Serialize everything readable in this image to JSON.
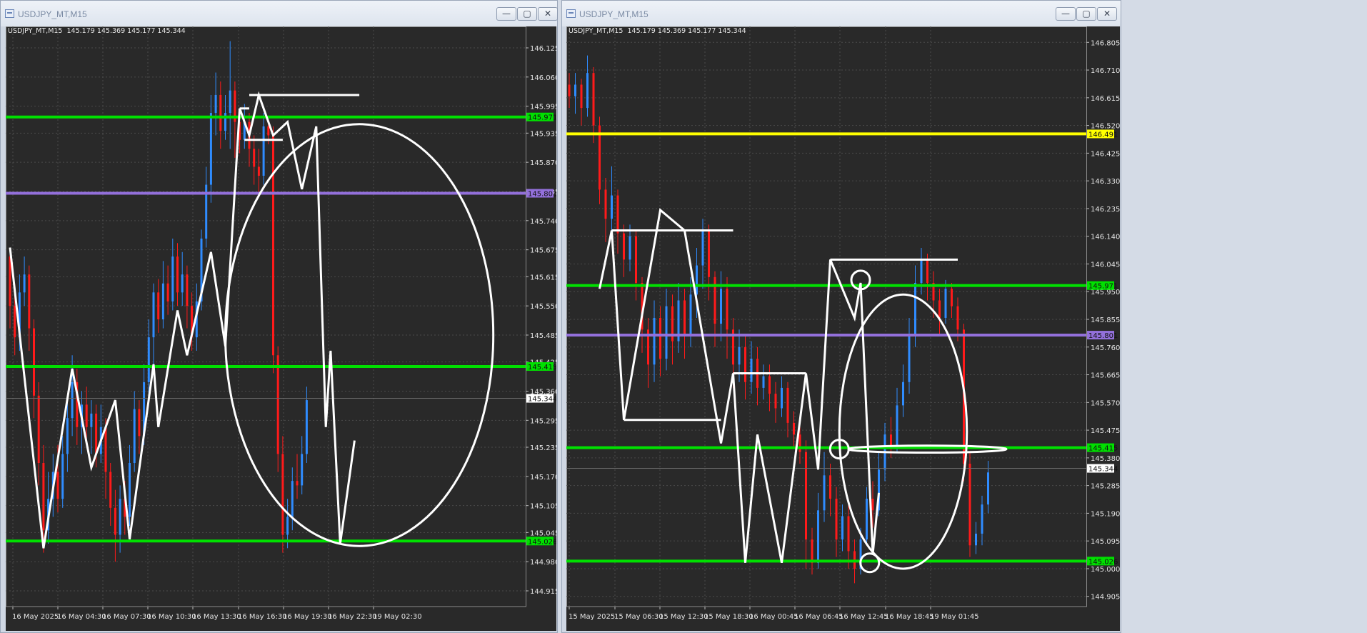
{
  "windows": [
    {
      "title": "USDJPY_MT,M15",
      "info": "USDJPY_MT,M15  145.179 145.369 145.177 145.344",
      "price_axis": {
        "min": 144.88,
        "max": 146.16,
        "ticks": [
          "146.125",
          "146.060",
          "145.995",
          "145.935",
          "145.870",
          "145.805",
          "145.740",
          "145.675",
          "145.615",
          "145.550",
          "145.485",
          "145.425",
          "145.360",
          "145.295",
          "145.235",
          "145.170",
          "145.105",
          "145.045",
          "144.980",
          "144.915"
        ]
      },
      "time_axis": {
        "labels": [
          "16 May 2025",
          "16 May 04:30",
          "16 May 07:30",
          "16 May 10:30",
          "16 May 13:30",
          "16 May 16:30",
          "16 May 19:30",
          "16 May 22:30",
          "19 May 02:30"
        ]
      },
      "levels": [
        {
          "price": 145.971,
          "label": "145.971",
          "color": "#00e000"
        },
        {
          "price": 145.801,
          "label": "145.801",
          "color": "#9370db"
        },
        {
          "price": 145.415,
          "label": "145.415",
          "color": "#00e000"
        },
        {
          "price": 145.026,
          "label": "145.026",
          "color": "#00e000"
        }
      ],
      "current_price": "145.344",
      "candles": [
        [
          145.66,
          145.55,
          145.68,
          145.5
        ],
        [
          145.55,
          145.48,
          145.6,
          145.44
        ],
        [
          145.48,
          145.58,
          145.62,
          145.45
        ],
        [
          145.58,
          145.62,
          145.66,
          145.55
        ],
        [
          145.62,
          145.5,
          145.64,
          145.45
        ],
        [
          145.5,
          145.35,
          145.52,
          145.3
        ],
        [
          145.35,
          145.2,
          145.38,
          145.15
        ],
        [
          145.2,
          145.05,
          145.24,
          145.0
        ],
        [
          145.05,
          145.12,
          145.18,
          145.02
        ],
        [
          145.12,
          145.18,
          145.22,
          145.08
        ],
        [
          145.18,
          145.12,
          145.24,
          145.09
        ],
        [
          145.12,
          145.22,
          145.26,
          145.1
        ],
        [
          145.22,
          145.3,
          145.35,
          145.18
        ],
        [
          145.3,
          145.38,
          145.44,
          145.26
        ],
        [
          145.38,
          145.28,
          145.41,
          145.24
        ],
        [
          145.28,
          145.33,
          145.36,
          145.22
        ],
        [
          145.33,
          145.28,
          145.37,
          145.25
        ],
        [
          145.28,
          145.31,
          145.34,
          145.22
        ],
        [
          145.31,
          145.22,
          145.33,
          145.19
        ],
        [
          145.22,
          145.28,
          145.33,
          145.2
        ],
        [
          145.28,
          145.18,
          145.3,
          145.12
        ],
        [
          145.18,
          145.1,
          145.2,
          145.06
        ],
        [
          145.1,
          145.04,
          145.14,
          144.98
        ],
        [
          145.04,
          145.12,
          145.15,
          145.0
        ],
        [
          145.12,
          145.08,
          145.16,
          145.04
        ],
        [
          145.08,
          145.2,
          145.24,
          145.06
        ],
        [
          145.2,
          145.32,
          145.36,
          145.18
        ],
        [
          145.32,
          145.26,
          145.34,
          145.22
        ],
        [
          145.26,
          145.38,
          145.42,
          145.24
        ],
        [
          145.38,
          145.48,
          145.52,
          145.34
        ],
        [
          145.48,
          145.58,
          145.6,
          145.42
        ],
        [
          145.58,
          145.52,
          145.61,
          145.49
        ],
        [
          145.52,
          145.6,
          145.65,
          145.5
        ],
        [
          145.6,
          145.56,
          145.64,
          145.53
        ],
        [
          145.56,
          145.66,
          145.7,
          145.54
        ],
        [
          145.66,
          145.58,
          145.69,
          145.55
        ],
        [
          145.58,
          145.62,
          145.67,
          145.55
        ],
        [
          145.62,
          145.55,
          145.64,
          145.5
        ],
        [
          145.55,
          145.48,
          145.58,
          145.45
        ],
        [
          145.48,
          145.56,
          145.6,
          145.45
        ],
        [
          145.56,
          145.7,
          145.72,
          145.54
        ],
        [
          145.7,
          145.82,
          145.86,
          145.68
        ],
        [
          145.82,
          145.98,
          146.02,
          145.78
        ],
        [
          145.98,
          146.02,
          146.07,
          145.93
        ],
        [
          146.02,
          145.94,
          146.05,
          145.9
        ],
        [
          145.94,
          145.98,
          146.02,
          145.92
        ],
        [
          145.98,
          146.03,
          146.14,
          145.9
        ],
        [
          146.03,
          145.96,
          146.05,
          145.88
        ],
        [
          145.96,
          145.92,
          145.99,
          145.89
        ],
        [
          145.92,
          145.96,
          146.0,
          145.9
        ],
        [
          145.96,
          145.9,
          145.98,
          145.86
        ],
        [
          145.9,
          145.86,
          145.93,
          145.82
        ],
        [
          145.86,
          145.84,
          145.9,
          145.8
        ],
        [
          145.84,
          145.95,
          145.98,
          145.82
        ],
        [
          145.95,
          145.93,
          145.96,
          145.91
        ],
        [
          145.93,
          145.44,
          145.95,
          145.4
        ],
        [
          145.44,
          145.22,
          145.46,
          145.18
        ],
        [
          145.22,
          145.04,
          145.26,
          145.0
        ],
        [
          145.04,
          145.08,
          145.12,
          145.01
        ],
        [
          145.08,
          145.16,
          145.19,
          145.05
        ],
        [
          145.16,
          145.15,
          145.22,
          145.12
        ],
        [
          145.15,
          145.22,
          145.26,
          145.13
        ],
        [
          145.22,
          145.34,
          145.37,
          145.2
        ]
      ],
      "drawing_polyline": [
        [
          0,
          145.68
        ],
        [
          7,
          145.01
        ],
        [
          13,
          145.41
        ],
        [
          17,
          145.19
        ],
        [
          22,
          145.34
        ],
        [
          25,
          145.03
        ],
        [
          30,
          145.42
        ],
        [
          31,
          145.28
        ],
        [
          35,
          145.54
        ],
        [
          37,
          145.44
        ],
        [
          42,
          145.67
        ],
        [
          45,
          145.46
        ],
        [
          48,
          145.99
        ],
        [
          50,
          145.93
        ],
        [
          52,
          146.02
        ],
        [
          55,
          145.93
        ],
        [
          58,
          145.96
        ],
        [
          61,
          145.81
        ],
        [
          64,
          145.95
        ],
        [
          66,
          145.28
        ],
        [
          67,
          145.45
        ],
        [
          69,
          145.02
        ],
        [
          72,
          145.25
        ]
      ],
      "drawing_hlines": [
        {
          "price": 146.02,
          "from": 50,
          "to": 73
        },
        {
          "price": 145.99,
          "from": 48,
          "to": 50
        },
        {
          "price": 145.92,
          "from": 49,
          "to": 57
        }
      ],
      "ellipse": {
        "cx_bar": 73,
        "cy_price": 145.485,
        "rx_bars": 28,
        "ry_price": 0.47
      }
    },
    {
      "title": "USDJPY_MT,M15",
      "info": "USDJPY_MT,M15  145.179 145.369 145.177 145.344",
      "price_axis": {
        "min": 144.87,
        "max": 146.84,
        "ticks": [
          "146.805",
          "146.710",
          "146.615",
          "146.520",
          "146.425",
          "146.330",
          "146.235",
          "146.140",
          "146.045",
          "145.950",
          "145.855",
          "145.760",
          "145.665",
          "145.570",
          "145.475",
          "145.380",
          "145.285",
          "145.190",
          "145.095",
          "145.000",
          "144.905"
        ]
      },
      "time_axis": {
        "labels": [
          "15 May 2025",
          "15 May 06:30",
          "15 May 12:30",
          "15 May 18:30",
          "16 May 00:45",
          "16 May 06:45",
          "16 May 12:45",
          "16 May 18:45",
          "19 May 01:45"
        ]
      },
      "levels": [
        {
          "price": 146.491,
          "label": "146.491",
          "color": "#ffff00"
        },
        {
          "price": 145.971,
          "label": "145.971",
          "color": "#00e000"
        },
        {
          "price": 145.801,
          "label": "145.801",
          "color": "#9370db"
        },
        {
          "price": 145.415,
          "label": "145.415",
          "color": "#00e000"
        },
        {
          "price": 145.026,
          "label": "145.026",
          "color": "#00e000"
        }
      ],
      "current_price": "145.344",
      "candles": [
        [
          146.66,
          146.62,
          146.7,
          146.58
        ],
        [
          146.62,
          146.66,
          146.7,
          146.56
        ],
        [
          146.66,
          146.58,
          146.68,
          146.52
        ],
        [
          146.58,
          146.7,
          146.76,
          146.55
        ],
        [
          146.7,
          146.52,
          146.72,
          146.46
        ],
        [
          146.52,
          146.3,
          146.55,
          146.25
        ],
        [
          146.3,
          146.2,
          146.34,
          146.12
        ],
        [
          146.2,
          146.28,
          146.38,
          146.15
        ],
        [
          146.28,
          146.15,
          146.3,
          146.08
        ],
        [
          146.15,
          146.06,
          146.18,
          146.0
        ],
        [
          146.06,
          146.14,
          146.18,
          146.02
        ],
        [
          146.14,
          145.98,
          146.16,
          145.92
        ],
        [
          145.98,
          145.82,
          146.0,
          145.74
        ],
        [
          145.82,
          145.7,
          145.86,
          145.62
        ],
        [
          145.7,
          145.86,
          145.92,
          145.64
        ],
        [
          145.86,
          145.72,
          145.9,
          145.66
        ],
        [
          145.72,
          145.9,
          145.96,
          145.68
        ],
        [
          145.9,
          145.78,
          145.94,
          145.7
        ],
        [
          145.78,
          145.92,
          145.98,
          145.74
        ],
        [
          145.92,
          145.8,
          145.96,
          145.72
        ],
        [
          145.8,
          145.94,
          146.0,
          145.76
        ],
        [
          145.94,
          146.04,
          146.1,
          145.86
        ],
        [
          146.04,
          146.16,
          146.2,
          145.96
        ],
        [
          146.16,
          146.0,
          146.18,
          145.92
        ],
        [
          146.0,
          145.84,
          146.02,
          145.76
        ],
        [
          145.84,
          145.96,
          146.02,
          145.78
        ],
        [
          145.96,
          145.82,
          146.0,
          145.72
        ],
        [
          145.82,
          145.7,
          145.86,
          145.62
        ],
        [
          145.7,
          145.76,
          145.82,
          145.64
        ],
        [
          145.76,
          145.64,
          145.8,
          145.58
        ],
        [
          145.64,
          145.72,
          145.78,
          145.6
        ],
        [
          145.72,
          145.62,
          145.76,
          145.56
        ],
        [
          145.62,
          145.66,
          145.7,
          145.58
        ],
        [
          145.66,
          145.6,
          145.7,
          145.54
        ],
        [
          145.6,
          145.55,
          145.64,
          145.5
        ],
        [
          145.55,
          145.62,
          145.66,
          145.52
        ],
        [
          145.62,
          145.5,
          145.64,
          145.45
        ],
        [
          145.5,
          145.46,
          145.54,
          145.42
        ],
        [
          145.46,
          145.4,
          145.52,
          145.36
        ],
        [
          145.4,
          145.1,
          145.44,
          145.0
        ],
        [
          145.1,
          145.02,
          145.14,
          144.98
        ],
        [
          145.02,
          145.2,
          145.26,
          145.0
        ],
        [
          145.2,
          145.32,
          145.4,
          145.16
        ],
        [
          145.32,
          145.24,
          145.36,
          145.18
        ],
        [
          145.24,
          145.1,
          145.28,
          145.04
        ],
        [
          145.1,
          145.18,
          145.22,
          145.06
        ],
        [
          145.18,
          145.06,
          145.22,
          145.0
        ],
        [
          145.06,
          145.0,
          145.1,
          144.95
        ],
        [
          145.0,
          145.1,
          145.14,
          144.98
        ],
        [
          145.1,
          145.24,
          145.28,
          145.08
        ],
        [
          145.24,
          145.2,
          145.3,
          145.14
        ],
        [
          145.2,
          145.34,
          145.4,
          145.18
        ],
        [
          145.34,
          145.46,
          145.5,
          145.3
        ],
        [
          145.46,
          145.42,
          145.52,
          145.38
        ],
        [
          145.42,
          145.56,
          145.62,
          145.4
        ],
        [
          145.56,
          145.64,
          145.7,
          145.52
        ],
        [
          145.64,
          145.8,
          145.86,
          145.6
        ],
        [
          145.8,
          145.98,
          146.04,
          145.76
        ],
        [
          145.98,
          146.06,
          146.1,
          145.94
        ],
        [
          146.06,
          145.98,
          146.08,
          145.92
        ],
        [
          145.98,
          145.92,
          146.02,
          145.86
        ],
        [
          145.92,
          145.86,
          145.96,
          145.8
        ],
        [
          145.86,
          145.96,
          145.99,
          145.84
        ],
        [
          145.96,
          145.9,
          145.98,
          145.86
        ],
        [
          145.9,
          145.82,
          145.93,
          145.78
        ],
        [
          145.82,
          145.36,
          145.84,
          145.3
        ],
        [
          145.36,
          145.08,
          145.4,
          145.04
        ],
        [
          145.08,
          145.12,
          145.16,
          145.05
        ],
        [
          145.12,
          145.22,
          145.25,
          145.08
        ],
        [
          145.22,
          145.33,
          145.37,
          145.19
        ]
      ],
      "drawing_polyline": [
        [
          5,
          145.96
        ],
        [
          7,
          146.16
        ],
        [
          9,
          145.51
        ],
        [
          15,
          146.23
        ],
        [
          19,
          146.16
        ],
        [
          25,
          145.43
        ],
        [
          27,
          145.67
        ],
        [
          29,
          145.02
        ],
        [
          31,
          145.46
        ],
        [
          35,
          145.02
        ],
        [
          39,
          145.67
        ],
        [
          41,
          145.34
        ],
        [
          43,
          146.06
        ],
        [
          47,
          145.86
        ],
        [
          48,
          145.98
        ],
        [
          50,
          145.05
        ],
        [
          51,
          145.26
        ]
      ],
      "drawing_hlines": [
        {
          "price": 146.16,
          "from": 7,
          "to": 27
        },
        {
          "price": 145.51,
          "from": 9,
          "to": 25
        },
        {
          "price": 145.67,
          "from": 27,
          "to": 39
        },
        {
          "price": 146.06,
          "from": 43,
          "to": 64
        }
      ],
      "ellipse": {
        "cx_bar": 55,
        "cy_price": 145.47,
        "rx_bars": 10.5,
        "ry_price": 0.47
      },
      "flat_ellipse": {
        "cx_bar": 59,
        "cy_price": 145.41,
        "rx_bars": 13,
        "ry_price": 0.012
      },
      "small_circles": [
        {
          "bar": 48,
          "price": 145.99
        },
        {
          "bar": 44.5,
          "price": 145.41
        },
        {
          "bar": 49.5,
          "price": 145.02
        }
      ]
    }
  ]
}
